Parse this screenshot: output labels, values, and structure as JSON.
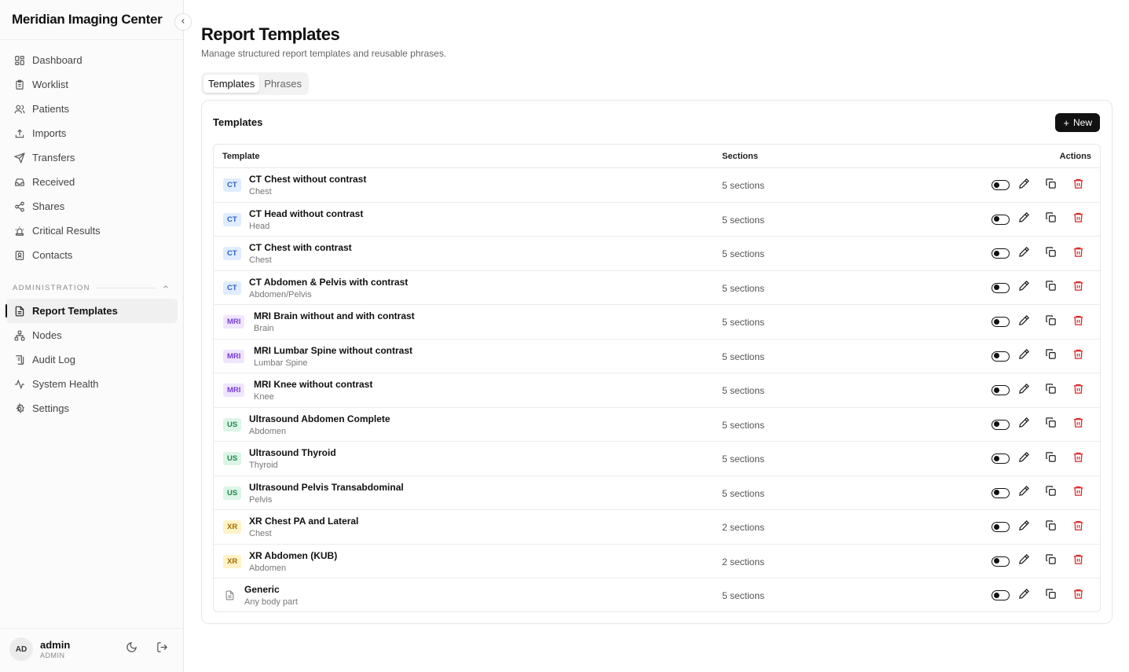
{
  "app": {
    "name": "Meridian Imaging Center"
  },
  "nav": {
    "items": [
      {
        "label": "Dashboard",
        "icon": "dashboard-icon"
      },
      {
        "label": "Worklist",
        "icon": "clipboard-icon"
      },
      {
        "label": "Patients",
        "icon": "users-icon"
      },
      {
        "label": "Imports",
        "icon": "upload-icon"
      },
      {
        "label": "Transfers",
        "icon": "send-icon"
      },
      {
        "label": "Received",
        "icon": "inbox-icon"
      },
      {
        "label": "Shares",
        "icon": "share-icon"
      },
      {
        "label": "Critical Results",
        "icon": "siren-icon"
      },
      {
        "label": "Contacts",
        "icon": "contact-icon"
      }
    ],
    "admin_heading": "ADMINISTRATION",
    "admin_items": [
      {
        "label": "Report Templates",
        "icon": "file-text-icon",
        "active": true
      },
      {
        "label": "Nodes",
        "icon": "network-icon"
      },
      {
        "label": "Audit Log",
        "icon": "scroll-icon"
      },
      {
        "label": "System Health",
        "icon": "activity-icon"
      },
      {
        "label": "Settings",
        "icon": "gear-icon"
      }
    ]
  },
  "user": {
    "initials": "AD",
    "name": "admin",
    "role": "ADMIN"
  },
  "page": {
    "title": "Report Templates",
    "subtitle": "Manage structured report templates and reusable phrases.",
    "tabs": [
      "Templates",
      "Phrases"
    ],
    "active_tab": "Templates"
  },
  "card": {
    "title": "Templates",
    "new_label": "New"
  },
  "table": {
    "headers": {
      "template": "Template",
      "sections": "Sections",
      "actions": "Actions"
    },
    "rows": [
      {
        "modality": "CT",
        "name": "CT Chest without contrast",
        "body_part": "Chest",
        "sections": "5 sections"
      },
      {
        "modality": "CT",
        "name": "CT Head without contrast",
        "body_part": "Head",
        "sections": "5 sections"
      },
      {
        "modality": "CT",
        "name": "CT Chest with contrast",
        "body_part": "Chest",
        "sections": "5 sections"
      },
      {
        "modality": "CT",
        "name": "CT Abdomen & Pelvis with contrast",
        "body_part": "Abdomen/Pelvis",
        "sections": "5 sections"
      },
      {
        "modality": "MRI",
        "name": "MRI Brain without and with contrast",
        "body_part": "Brain",
        "sections": "5 sections"
      },
      {
        "modality": "MRI",
        "name": "MRI Lumbar Spine without contrast",
        "body_part": "Lumbar Spine",
        "sections": "5 sections"
      },
      {
        "modality": "MRI",
        "name": "MRI Knee without contrast",
        "body_part": "Knee",
        "sections": "5 sections"
      },
      {
        "modality": "US",
        "name": "Ultrasound Abdomen Complete",
        "body_part": "Abdomen",
        "sections": "5 sections"
      },
      {
        "modality": "US",
        "name": "Ultrasound Thyroid",
        "body_part": "Thyroid",
        "sections": "5 sections"
      },
      {
        "modality": "US",
        "name": "Ultrasound Pelvis Transabdominal",
        "body_part": "Pelvis",
        "sections": "5 sections"
      },
      {
        "modality": "XR",
        "name": "XR Chest PA and Lateral",
        "body_part": "Chest",
        "sections": "2 sections"
      },
      {
        "modality": "XR",
        "name": "XR Abdomen (KUB)",
        "body_part": "Abdomen",
        "sections": "2 sections"
      },
      {
        "modality": "",
        "name": "Generic",
        "body_part": "Any body part",
        "sections": "5 sections"
      }
    ]
  },
  "colors": {
    "accent": "#111111",
    "danger": "#dc2626"
  }
}
